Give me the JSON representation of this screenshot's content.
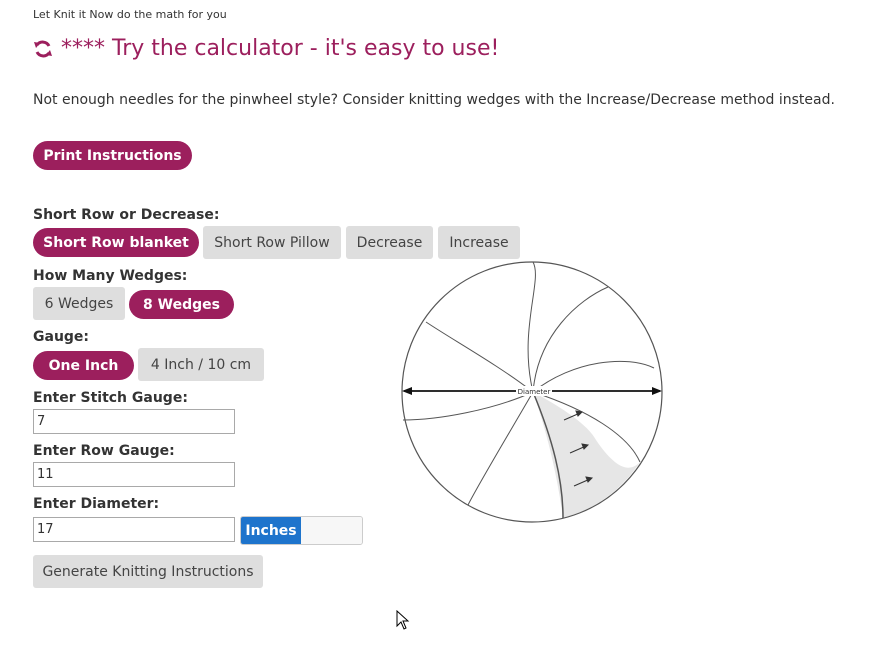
{
  "intro": "Let Knit it Now do the math for you",
  "heading": "**** Try the calculator - it's easy to use!",
  "note": "Not enough needles for the pinwheel style? Consider knitting wedges with the Increase/Decrease method instead.",
  "print_button": "Print Instructions",
  "method": {
    "label": "Short Row or Decrease:",
    "options": [
      "Short Row blanket",
      "Short Row Pillow",
      "Decrease",
      "Increase"
    ],
    "selected": "Short Row blanket"
  },
  "wedges": {
    "label": "How Many Wedges:",
    "options": [
      "6 Wedges",
      "8 Wedges"
    ],
    "selected": "8 Wedges"
  },
  "gauge": {
    "label": "Gauge:",
    "options": [
      "One Inch",
      "4 Inch / 10 cm"
    ],
    "selected": "One Inch"
  },
  "stitch_gauge": {
    "label": "Enter Stitch Gauge:",
    "value": "7"
  },
  "row_gauge": {
    "label": "Enter Row Gauge:",
    "value": "11"
  },
  "diameter": {
    "label": "Enter Diameter:",
    "value": "17",
    "unit_toggle": "Inches"
  },
  "generate_button": "Generate Knitting Instructions",
  "diagram": {
    "diameter_label": "Diameter"
  },
  "colors": {
    "accent": "#9c1f5d",
    "toggle_on": "#1e74cc",
    "button_gray": "#dedede"
  }
}
